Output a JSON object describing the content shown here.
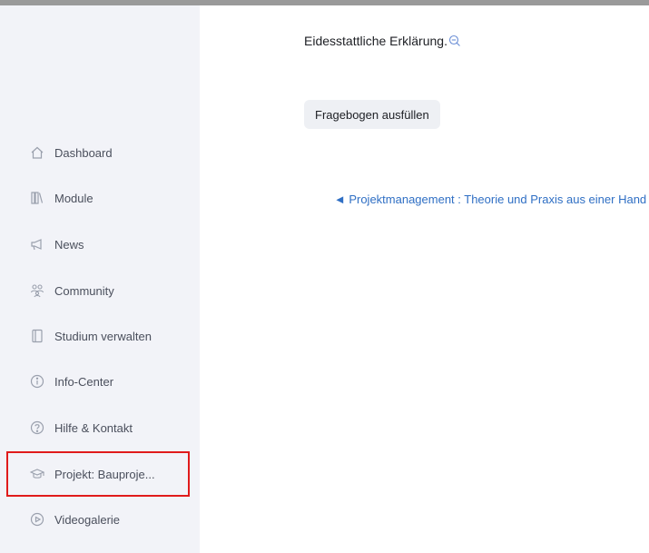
{
  "sidebar": {
    "items": [
      {
        "label": "Dashboard",
        "icon": "home-icon"
      },
      {
        "label": "Module",
        "icon": "library-icon"
      },
      {
        "label": "News",
        "icon": "megaphone-icon"
      },
      {
        "label": "Community",
        "icon": "people-icon"
      },
      {
        "label": "Studium verwalten",
        "icon": "book-icon"
      },
      {
        "label": "Info-Center",
        "icon": "info-icon"
      },
      {
        "label": "Hilfe & Kontakt",
        "icon": "help-icon"
      },
      {
        "label": "Projekt: Bauproje...",
        "icon": "graduation-cap-icon"
      },
      {
        "label": "Videogalerie",
        "icon": "play-icon"
      }
    ]
  },
  "main": {
    "title": "Eidesstattliche Erklärung.",
    "button_label": "Fragebogen ausfüllen",
    "prev_link": "◄ Projektmanagement : Theorie und Praxis aus einer Hand"
  },
  "colors": {
    "highlight": "#e01b1b",
    "link": "#2f6fc4",
    "sidebar_bg": "#f2f3f8"
  }
}
